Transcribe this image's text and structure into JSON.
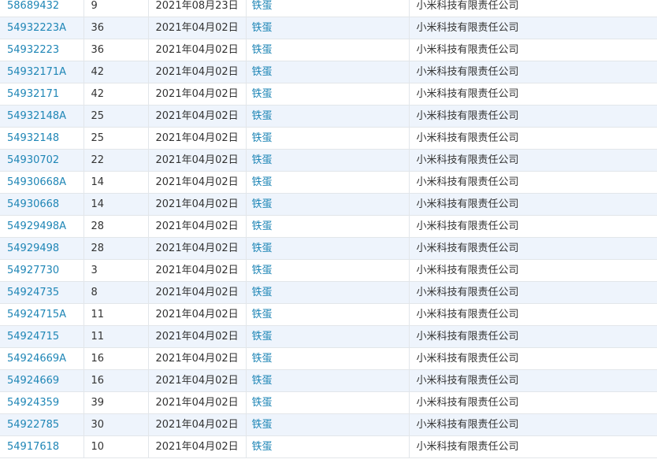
{
  "table": {
    "rows": [
      {
        "reg_no": "58689432",
        "class": "9",
        "date": "2021年08月23日",
        "name": "铁蛋",
        "applicant": "小米科技有限责任公司"
      },
      {
        "reg_no": "54932223A",
        "class": "36",
        "date": "2021年04月02日",
        "name": "铁蛋",
        "applicant": "小米科技有限责任公司"
      },
      {
        "reg_no": "54932223",
        "class": "36",
        "date": "2021年04月02日",
        "name": "铁蛋",
        "applicant": "小米科技有限责任公司"
      },
      {
        "reg_no": "54932171A",
        "class": "42",
        "date": "2021年04月02日",
        "name": "铁蛋",
        "applicant": "小米科技有限责任公司"
      },
      {
        "reg_no": "54932171",
        "class": "42",
        "date": "2021年04月02日",
        "name": "铁蛋",
        "applicant": "小米科技有限责任公司"
      },
      {
        "reg_no": "54932148A",
        "class": "25",
        "date": "2021年04月02日",
        "name": "铁蛋",
        "applicant": "小米科技有限责任公司"
      },
      {
        "reg_no": "54932148",
        "class": "25",
        "date": "2021年04月02日",
        "name": "铁蛋",
        "applicant": "小米科技有限责任公司"
      },
      {
        "reg_no": "54930702",
        "class": "22",
        "date": "2021年04月02日",
        "name": "铁蛋",
        "applicant": "小米科技有限责任公司"
      },
      {
        "reg_no": "54930668A",
        "class": "14",
        "date": "2021年04月02日",
        "name": "铁蛋",
        "applicant": "小米科技有限责任公司"
      },
      {
        "reg_no": "54930668",
        "class": "14",
        "date": "2021年04月02日",
        "name": "铁蛋",
        "applicant": "小米科技有限责任公司"
      },
      {
        "reg_no": "54929498A",
        "class": "28",
        "date": "2021年04月02日",
        "name": "铁蛋",
        "applicant": "小米科技有限责任公司"
      },
      {
        "reg_no": "54929498",
        "class": "28",
        "date": "2021年04月02日",
        "name": "铁蛋",
        "applicant": "小米科技有限责任公司"
      },
      {
        "reg_no": "54927730",
        "class": "3",
        "date": "2021年04月02日",
        "name": "铁蛋",
        "applicant": "小米科技有限责任公司"
      },
      {
        "reg_no": "54924735",
        "class": "8",
        "date": "2021年04月02日",
        "name": "铁蛋",
        "applicant": "小米科技有限责任公司"
      },
      {
        "reg_no": "54924715A",
        "class": "11",
        "date": "2021年04月02日",
        "name": "铁蛋",
        "applicant": "小米科技有限责任公司"
      },
      {
        "reg_no": "54924715",
        "class": "11",
        "date": "2021年04月02日",
        "name": "铁蛋",
        "applicant": "小米科技有限责任公司"
      },
      {
        "reg_no": "54924669A",
        "class": "16",
        "date": "2021年04月02日",
        "name": "铁蛋",
        "applicant": "小米科技有限责任公司"
      },
      {
        "reg_no": "54924669",
        "class": "16",
        "date": "2021年04月02日",
        "name": "铁蛋",
        "applicant": "小米科技有限责任公司"
      },
      {
        "reg_no": "54924359",
        "class": "39",
        "date": "2021年04月02日",
        "name": "铁蛋",
        "applicant": "小米科技有限责任公司"
      },
      {
        "reg_no": "54922785",
        "class": "30",
        "date": "2021年04月02日",
        "name": "铁蛋",
        "applicant": "小米科技有限责任公司"
      },
      {
        "reg_no": "54917618",
        "class": "10",
        "date": "2021年04月02日",
        "name": "铁蛋",
        "applicant": "小米科技有限责任公司"
      }
    ]
  },
  "colors": {
    "link": "#1f86b6",
    "text": "#333333",
    "row_alt": "#eef4fc",
    "border": "#e2e6ea"
  }
}
